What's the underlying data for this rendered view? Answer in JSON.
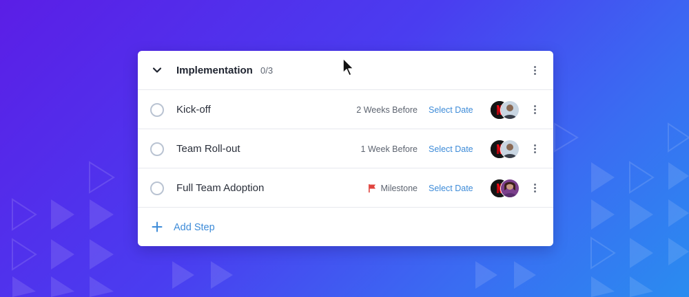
{
  "section": {
    "title": "Implementation",
    "progress": "0/3"
  },
  "steps": [
    {
      "label": "Kick-off",
      "timing": "2 Weeks Before",
      "date_action": "Select Date",
      "flag": false
    },
    {
      "label": "Team Roll-out",
      "timing": "1 Week Before",
      "date_action": "Select Date",
      "flag": false
    },
    {
      "label": "Full Team Adoption",
      "timing": "Milestone",
      "date_action": "Select Date",
      "flag": true
    }
  ],
  "add_step": {
    "label": "Add Step"
  },
  "colors": {
    "accent": "#3d8bd8",
    "milestone_flag": "#e0443e",
    "brand_avatar": "#e50914"
  },
  "icons": {
    "collapse": "chevron-down-icon",
    "more": "kebab-menu-icon",
    "add": "plus-icon",
    "milestone": "flag-icon",
    "status": "circle-check-icon"
  }
}
